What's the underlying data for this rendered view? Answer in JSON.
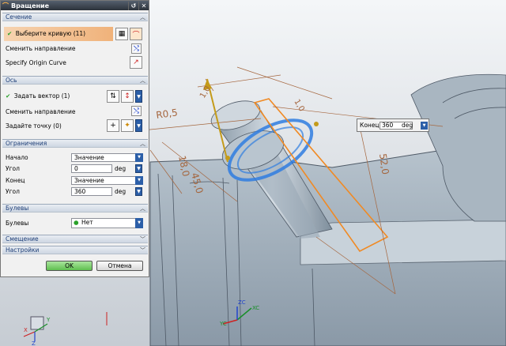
{
  "dialog": {
    "title": "Вращение",
    "sections": {
      "section": "Сечение",
      "axis": "Ось",
      "limits": "Ограничения",
      "boolean": "Булевы",
      "offset": "Смещение",
      "settings": "Настройки"
    },
    "section_group": {
      "select_curve": "Выберите кривую (11)",
      "reverse_direction": "Сменить направление",
      "specify_origin_curve": "Specify Origin Curve"
    },
    "axis_group": {
      "specify_vector": "Задать вектор (1)",
      "reverse_direction": "Сменить направление",
      "specify_point": "Задайте точку (0)"
    },
    "limits_group": {
      "start_label": "Начало",
      "start_value": "Значение",
      "angle1_label": "Угол",
      "angle1_value": "0",
      "angle1_unit": "deg",
      "end_label": "Конец",
      "end_value": "Значение",
      "angle2_label": "Угол",
      "angle2_value": "360",
      "angle2_unit": "deg"
    },
    "boolean_group": {
      "label": "Булевы",
      "value": "Нет"
    },
    "ok_label": "OK",
    "cancel_label": "Отмена"
  },
  "end_box": {
    "label": "Конец",
    "value": "360",
    "unit": "deg"
  },
  "dimensions": {
    "r05": "R0,5",
    "d10a": "1,0",
    "d10b": "1,0",
    "d18": "18,0",
    "d45": "45,0",
    "d520": "52,0"
  },
  "axes": {
    "xc": "XC",
    "yc": "YC",
    "zc": "ZC",
    "x": "X",
    "y": "Y",
    "z": "Z"
  },
  "colors": {
    "accent": "#f08a24",
    "selection_blue": "#2f7de0",
    "ok_green": "#5fbf4f"
  }
}
